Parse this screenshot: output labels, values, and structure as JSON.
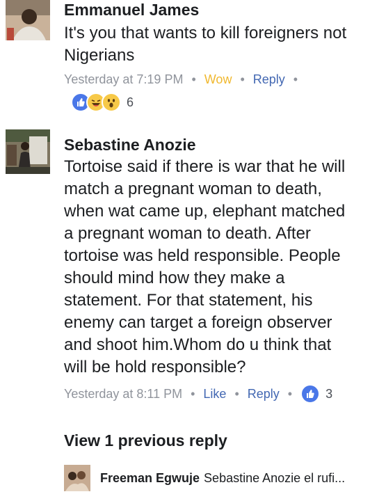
{
  "comments": [
    {
      "author": "Emmanuel James",
      "text_lines": [
        "It's you that wants to kill foreigners not",
        "Nigerians"
      ],
      "timestamp": "Yesterday at 7:19 PM",
      "reaction_label": "Wow",
      "reply_label": "Reply",
      "reaction_icons": [
        "like-icon",
        "haha-icon",
        "wow-icon"
      ],
      "reaction_count": "6"
    },
    {
      "author": "Sebastine Anozie",
      "text_lines": [
        "Tortoise said if there is war that he will",
        "match a pregnant woman to death,",
        "when wat came up, elephant  matched",
        "a pregnant woman to death. After",
        "tortoise was held responsible. People",
        "should mind how they make a",
        "statement. For that statement, his",
        "enemy can target a foreign observer",
        "and shoot him.Whom do u think that",
        "will be hold responsible?"
      ],
      "timestamp": "Yesterday at 8:11 PM",
      "like_label": "Like",
      "reply_label": "Reply",
      "reaction_icons": [
        "like-icon"
      ],
      "reaction_count": "3"
    }
  ],
  "view_previous": "View 1 previous reply",
  "reply_preview": {
    "author": "Freeman Egwuje",
    "snippet": "Sebastine Anozie el rufi..."
  },
  "colors": {
    "link": "#4267b2",
    "meta": "#90949c",
    "wow": "#f0b82f",
    "like_icon": "#4a77e8"
  }
}
